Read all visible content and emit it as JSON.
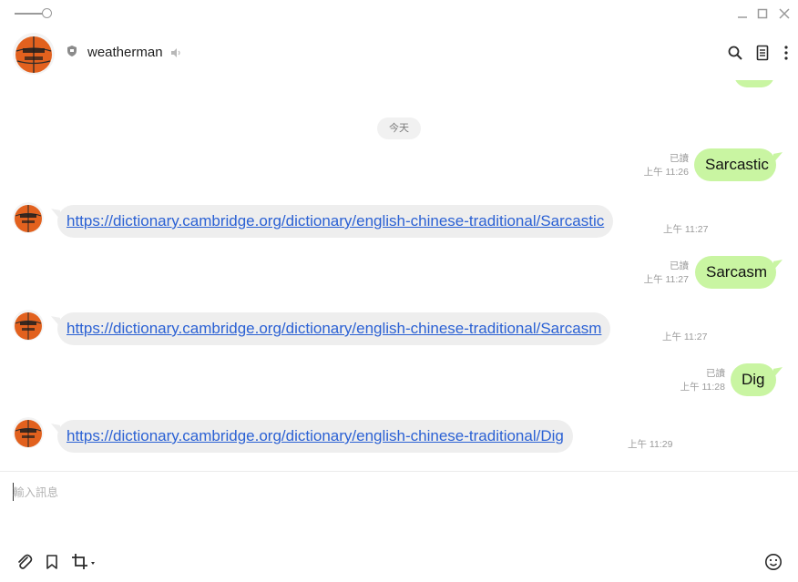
{
  "header": {
    "contact_name": "weatherman"
  },
  "chat": {
    "date_separator": "今天",
    "messages": [
      {
        "direction": "out",
        "text": "Sarcastic",
        "read": "已讀",
        "time": "上午 11:26"
      },
      {
        "direction": "in",
        "text": "https://dictionary.cambridge.org/dictionary/english-chinese-traditional/Sarcastic",
        "time": "上午 11:27"
      },
      {
        "direction": "out",
        "text": "Sarcasm",
        "read": "已讀",
        "time": "上午 11:27"
      },
      {
        "direction": "in",
        "text": "https://dictionary.cambridge.org/dictionary/english-chinese-traditional/Sarcasm",
        "time": "上午 11:27"
      },
      {
        "direction": "out",
        "text": "Dig",
        "read": "已讀",
        "time": "上午 11:28"
      },
      {
        "direction": "in",
        "text": "https://dictionary.cambridge.org/dictionary/english-chinese-traditional/Dig",
        "time": "上午 11:29"
      }
    ]
  },
  "composer": {
    "placeholder": "輸入訊息"
  },
  "icons": {
    "window": [
      "slider-icon",
      "minimize-icon",
      "maximize-icon",
      "close-icon"
    ],
    "header": [
      "shield-icon",
      "speaker-icon",
      "search-icon",
      "notes-icon",
      "more-icon"
    ],
    "toolbar": [
      "paperclip-icon",
      "bookmark-icon",
      "crop-icon",
      "emoji-icon"
    ]
  },
  "colors": {
    "outgoing_bubble": "#c9f5a2",
    "incoming_bubble": "#eeeeee",
    "link": "#2b61d4"
  }
}
